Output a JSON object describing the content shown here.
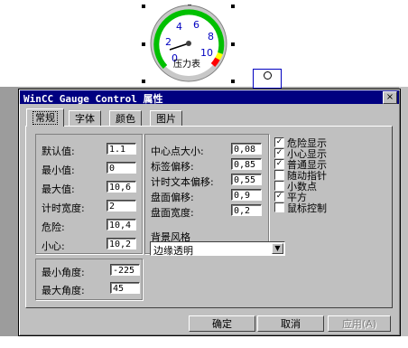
{
  "dialog": {
    "title": "WinCC Gauge Control 属性",
    "close_label": "×"
  },
  "gauge_preview": {
    "ticks": [
      "2",
      "4",
      "6",
      "8",
      "10",
      "0"
    ],
    "label": "压力表",
    "colors": {
      "face": "#ffffff",
      "safe_band": "#00c000",
      "warning": "#ffff00",
      "danger": "#ff0000",
      "needle": "#000000"
    }
  },
  "tabs": [
    {
      "label": "常规"
    },
    {
      "label": "字体"
    },
    {
      "label": "颜色"
    },
    {
      "label": "图片"
    }
  ],
  "values_group": {
    "fields": [
      {
        "label": "默认值:",
        "value": "1.1"
      },
      {
        "label": "最小值:",
        "value": "0"
      },
      {
        "label": "最大值:",
        "value": "10,6"
      },
      {
        "label": "计时宽度:",
        "value": "2"
      },
      {
        "label": "危险:",
        "value": "10,4"
      },
      {
        "label": "小心:",
        "value": "10,2"
      }
    ]
  },
  "geometry_group": {
    "fields": [
      {
        "label": "中心点大小:",
        "value": "0,08"
      },
      {
        "label": "标签偏移:",
        "value": "0,85"
      },
      {
        "label": "计时文本偏移:",
        "value": "0,55"
      },
      {
        "label": "盘面偏移:",
        "value": "0,9"
      },
      {
        "label": "盘面宽度:",
        "value": "0,2"
      }
    ]
  },
  "checkboxes": [
    {
      "label": "危险显示",
      "checked": true
    },
    {
      "label": "小心显示",
      "checked": true
    },
    {
      "label": "普通显示",
      "checked": true
    },
    {
      "label": "随动指针",
      "checked": false
    },
    {
      "label": "小数点",
      "checked": false
    },
    {
      "label": "平方",
      "checked": true
    },
    {
      "label": "鼠标控制",
      "checked": false
    }
  ],
  "angle_group": {
    "fields": [
      {
        "label": "最小角度:",
        "value": "-225"
      },
      {
        "label": "最大角度:",
        "value": "45"
      }
    ]
  },
  "background_style": {
    "label": "背景风格",
    "value": "边缘透明"
  },
  "buttons": {
    "ok": "确定",
    "cancel": "取消",
    "apply": "应用(A)"
  }
}
